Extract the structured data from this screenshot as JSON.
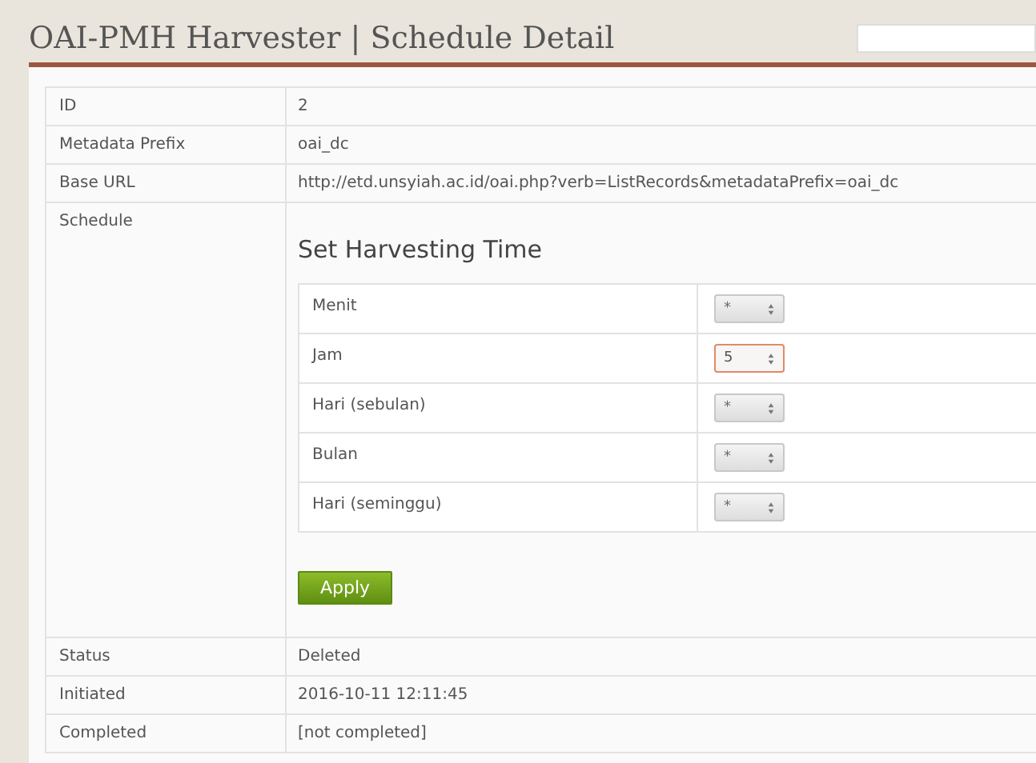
{
  "header": {
    "title": "OAI-PMH Harvester | Schedule Detail",
    "search": {
      "kind": "field"
    }
  },
  "details": [
    {
      "label": "ID",
      "kind": "text",
      "value": "2"
    },
    {
      "label": "Metadata Prefix",
      "kind": "text",
      "value": "oai_dc"
    },
    {
      "label": "Base URL",
      "kind": "text",
      "value": "http://etd.unsyiah.ac.id/oai.php?verb=ListRecords&metadataPrefix=oai_dc"
    },
    {
      "label": "Schedule",
      "kind": "schedule",
      "heading": "Set Harvesting Time",
      "fields": [
        {
          "label": "Menit",
          "value": "*",
          "focused": false
        },
        {
          "label": "Jam",
          "value": "5",
          "focused": true
        },
        {
          "label": "Hari (sebulan)",
          "value": "*",
          "focused": false
        },
        {
          "label": "Bulan",
          "value": "*",
          "focused": false
        },
        {
          "label": "Hari (seminggu)",
          "value": "*",
          "focused": false
        }
      ],
      "button": "Apply"
    },
    {
      "label": "Status",
      "kind": "text",
      "value": "Deleted"
    },
    {
      "label": "Initiated",
      "kind": "text",
      "value": "2016-10-11 12:11:45"
    },
    {
      "label": "Completed",
      "kind": "text",
      "value": "[not completed]"
    }
  ]
}
